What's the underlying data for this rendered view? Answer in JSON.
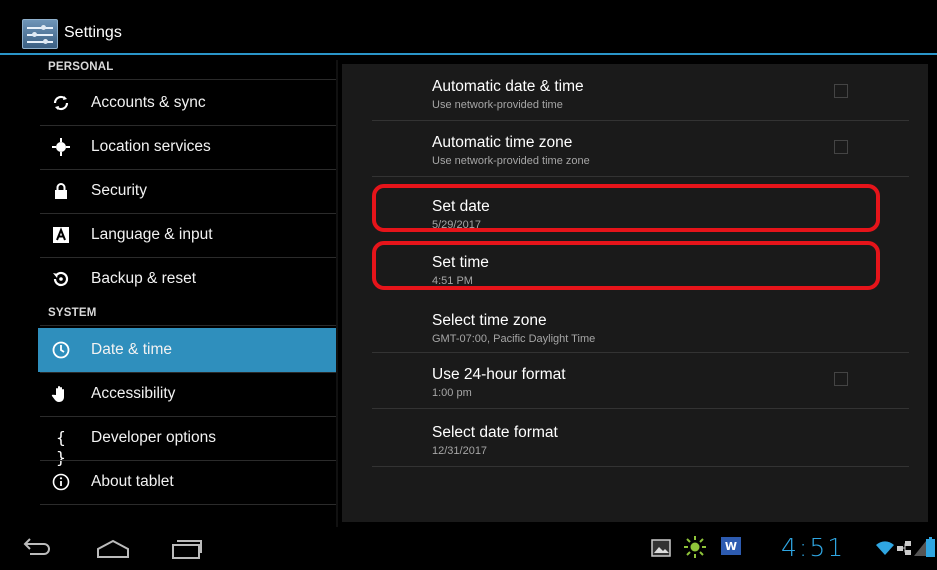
{
  "app": {
    "title": "Settings"
  },
  "sidebar": {
    "sections": [
      {
        "header": "PERSONAL"
      },
      {
        "header": "SYSTEM"
      }
    ],
    "items": [
      {
        "label": "Accounts & sync",
        "icon": "sync-icon"
      },
      {
        "label": "Location services",
        "icon": "location-icon"
      },
      {
        "label": "Security",
        "icon": "lock-icon"
      },
      {
        "label": "Language & input",
        "icon": "keyboard-icon"
      },
      {
        "label": "Backup & reset",
        "icon": "backup-icon"
      },
      {
        "label": "Date & time",
        "icon": "clock-icon",
        "selected": true
      },
      {
        "label": "Accessibility",
        "icon": "hand-icon"
      },
      {
        "label": "Developer options",
        "icon": "braces-icon"
      },
      {
        "label": "About tablet",
        "icon": "info-icon"
      }
    ]
  },
  "prefs": [
    {
      "title": "Automatic date & time",
      "summary": "Use network-provided time",
      "checkbox": true,
      "checked": false
    },
    {
      "title": "Automatic time zone",
      "summary": "Use network-provided time zone",
      "checkbox": true,
      "checked": false
    },
    {
      "title": "Set date",
      "summary": "5/29/2017",
      "checkbox": false,
      "highlighted": true
    },
    {
      "title": "Set time",
      "summary": "4:51 PM",
      "checkbox": false,
      "highlighted": true
    },
    {
      "title": "Select time zone",
      "summary": "GMT-07:00, Pacific Daylight Time",
      "checkbox": false
    },
    {
      "title": "Use 24-hour format",
      "summary": "1:00 pm",
      "checkbox": true,
      "checked": false
    },
    {
      "title": "Select date format",
      "summary": "12/31/2017",
      "checkbox": false
    }
  ],
  "navbar": {
    "buttons": [
      "back-icon",
      "home-icon",
      "recent-apps-icon"
    ],
    "status_icons": [
      "gallery-notification-icon",
      "brightness-icon",
      "word-notification-icon",
      "wifi-icon",
      "network-icon",
      "signal-icon",
      "battery-icon"
    ],
    "clock": "4:51"
  },
  "colors": {
    "accent": "#2f8fbd",
    "highlight": "#e6141a",
    "clock": "#2fa6e2"
  }
}
